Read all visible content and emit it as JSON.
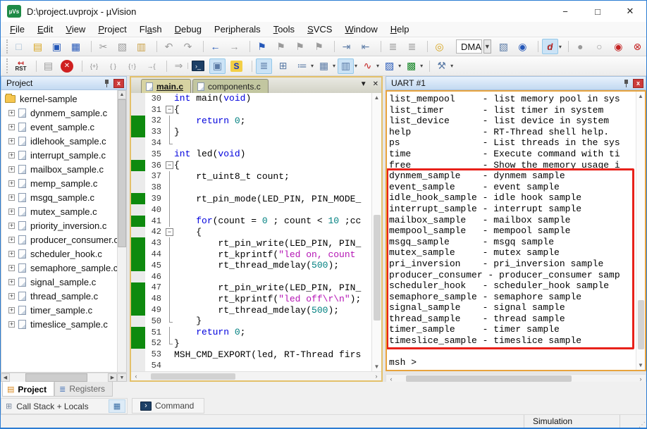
{
  "window": {
    "title": "D:\\project.uvprojx - µVision",
    "logo_text": "µVs",
    "controls": {
      "minimize": "−",
      "maximize": "□",
      "close": "✕"
    }
  },
  "menu": {
    "items": [
      {
        "pre": "",
        "key": "F",
        "post": "ile"
      },
      {
        "pre": "",
        "key": "E",
        "post": "dit"
      },
      {
        "pre": "",
        "key": "V",
        "post": "iew"
      },
      {
        "pre": "",
        "key": "P",
        "post": "roject"
      },
      {
        "pre": "Fl",
        "key": "a",
        "post": "sh"
      },
      {
        "pre": "",
        "key": "D",
        "post": "ebug"
      },
      {
        "pre": "Per",
        "key": "i",
        "post": "pherals"
      },
      {
        "pre": "",
        "key": "T",
        "post": "ools"
      },
      {
        "pre": "",
        "key": "S",
        "post": "VCS"
      },
      {
        "pre": "",
        "key": "W",
        "post": "indow"
      },
      {
        "pre": "",
        "key": "H",
        "post": "elp"
      }
    ]
  },
  "toolbar1a": [
    {
      "name": "new-file-button",
      "g": "□",
      "cls": "c-sky",
      "dd": ""
    },
    {
      "name": "open-button",
      "g": "▤",
      "cls": "c-yellow",
      "dd": ""
    },
    {
      "name": "save-button",
      "g": "▣",
      "cls": "c-blue",
      "dd": ""
    },
    {
      "name": "save-all-button",
      "g": "▦",
      "cls": "c-blue",
      "dd": ""
    },
    {
      "name": "cut-button",
      "g": "✂",
      "cls": "c-gray gs",
      "dd": ""
    },
    {
      "name": "copy-button",
      "g": "▧",
      "cls": "c-gray",
      "dd": ""
    },
    {
      "name": "paste-button",
      "g": "▥",
      "cls": "c-tan",
      "dd": ""
    },
    {
      "name": "undo-button",
      "g": "↶",
      "cls": "c-gray gs",
      "dd": ""
    },
    {
      "name": "redo-button",
      "g": "↷",
      "cls": "c-gray",
      "dd": ""
    },
    {
      "name": "nav-back-button",
      "g": "←",
      "cls": "c-blue gs",
      "dd": ""
    },
    {
      "name": "nav-forward-button",
      "g": "→",
      "cls": "c-gray",
      "dd": ""
    },
    {
      "name": "bookmark-button",
      "g": "⚑",
      "cls": "c-blue gs",
      "dd": ""
    },
    {
      "name": "next-bookmark-button",
      "g": "⚑",
      "cls": "c-gray",
      "dd": ""
    },
    {
      "name": "prev-bookmark-button",
      "g": "⚑",
      "cls": "c-gray",
      "dd": ""
    },
    {
      "name": "clear-bookmarks-button",
      "g": "⚑",
      "cls": "c-gray",
      "dd": ""
    },
    {
      "name": "indent-button",
      "g": "⇥",
      "cls": "c-slate gs",
      "dd": ""
    },
    {
      "name": "outdent-button",
      "g": "⇤",
      "cls": "c-slate",
      "dd": ""
    },
    {
      "name": "comment-button",
      "g": "≣",
      "cls": "c-gray gs",
      "dd": ""
    },
    {
      "name": "uncomment-button",
      "g": "≣",
      "cls": "c-gray",
      "dd": ""
    },
    {
      "name": "find-in-files-button",
      "g": "◎",
      "cls": "c-yellow gs",
      "dd": ""
    }
  ],
  "find_combo": {
    "value": "DMA",
    "arrow": "▼"
  },
  "toolbar1b": [
    {
      "name": "find-next-button",
      "g": "▧",
      "cls": "c-slate",
      "dd": ""
    },
    {
      "name": "incremental-find-button",
      "g": "◉",
      "cls": "c-blue",
      "dd": ""
    },
    {
      "name": "debug-session-button",
      "g": "d",
      "cls": "c-red pressed circ gs",
      "dd": "▾"
    },
    {
      "name": "insert-breakpoint-button",
      "g": "●",
      "cls": "c-gray gs",
      "dd": ""
    },
    {
      "name": "enable-breakpoint-button",
      "g": "○",
      "cls": "c-gray",
      "dd": ""
    },
    {
      "name": "disable-all-breakpoints-button",
      "g": "◉",
      "cls": "c-red",
      "dd": ""
    },
    {
      "name": "kill-all-breakpoints-button",
      "g": "⊗",
      "cls": "c-red",
      "dd": ""
    },
    {
      "name": "window-layout-button",
      "g": "▦",
      "cls": "c-blue pressed gs",
      "dd": ""
    }
  ],
  "toolbar2": [
    {
      "name": "reset-button",
      "g": "RST",
      "cls": "rst",
      "dd": ""
    },
    {
      "name": "run-button",
      "g": "▤",
      "cls": "c-gray gs",
      "dd": ""
    },
    {
      "name": "stop-button",
      "g": "✕",
      "cls": "stop",
      "dd": ""
    },
    {
      "name": "step-button",
      "g": "{+}",
      "cls": "txt gs",
      "dd": ""
    },
    {
      "name": "step-over-button",
      "g": "{ }",
      "cls": "txt",
      "dd": ""
    },
    {
      "name": "step-out-button",
      "g": "{↑}",
      "cls": "txt",
      "dd": ""
    },
    {
      "name": "run-to-line-button",
      "g": "→{",
      "cls": "txt",
      "dd": ""
    },
    {
      "name": "show-next-statement-button",
      "g": "⇒",
      "cls": "c-gray gs",
      "dd": ""
    },
    {
      "name": "command-window-button",
      "g": "›_",
      "cls": "cmdw gs",
      "dd": ""
    },
    {
      "name": "disassembly-window-button",
      "g": "▣",
      "cls": "c-slate pressed",
      "dd": ""
    },
    {
      "name": "symbol-window-button",
      "g": "S",
      "cls": "sym",
      "dd": ""
    },
    {
      "name": "registers-window-button",
      "g": "≣",
      "cls": "c-slate pressed gs",
      "dd": ""
    },
    {
      "name": "call-stack-window-button",
      "g": "⊞",
      "cls": "c-slate",
      "dd": ""
    },
    {
      "name": "watch-window-button",
      "g": "≔",
      "cls": "c-slate",
      "dd": "▾"
    },
    {
      "name": "memory-window-button",
      "g": "▦",
      "cls": "c-slate",
      "dd": "▾"
    },
    {
      "name": "serial-window-button",
      "g": "▥",
      "cls": "c-slate pressed",
      "dd": "▾"
    },
    {
      "name": "analysis-window-button",
      "g": "∿",
      "cls": "c-red",
      "dd": "▾"
    },
    {
      "name": "trace-window-button",
      "g": "▨",
      "cls": "c-blue",
      "dd": "▾"
    },
    {
      "name": "system-viewer-button",
      "g": "▩",
      "cls": "c-green",
      "dd": "▾"
    },
    {
      "name": "toolbox-button",
      "g": "⚒",
      "cls": "c-slate gs",
      "dd": "▾"
    }
  ],
  "project_panel": {
    "title": "Project",
    "root": "kernel-sample",
    "files": [
      "dynmem_sample.c",
      "event_sample.c",
      "idlehook_sample.c",
      "interrupt_sample.c",
      "mailbox_sample.c",
      "memp_sample.c",
      "msgq_sample.c",
      "mutex_sample.c",
      "priority_inversion.c",
      "producer_consumer.c",
      "scheduler_hook.c",
      "semaphore_sample.c",
      "signal_sample.c",
      "thread_sample.c",
      "timer_sample.c",
      "timeslice_sample.c"
    ]
  },
  "editor": {
    "tabs": [
      {
        "label": "main.c"
      },
      {
        "label": "components.c"
      }
    ],
    "tab_overflow": "▼",
    "tab_close": "✕",
    "lines": [
      {
        "n": "30",
        "t": "int main(void)",
        "f": "",
        "cc": ""
      },
      {
        "n": "31",
        "t": "{",
        "f": "box",
        "cc": ""
      },
      {
        "n": "32",
        "t": "    return 0;",
        "f": "v",
        "cc": "on"
      },
      {
        "n": "33",
        "t": "}",
        "f": "v",
        "cc": "on"
      },
      {
        "n": "34",
        "t": "",
        "f": "end",
        "cc": ""
      },
      {
        "n": "35",
        "t": "int led(void)",
        "f": "",
        "cc": ""
      },
      {
        "n": "36",
        "t": "{",
        "f": "box",
        "cc": "on"
      },
      {
        "n": "37",
        "t": "    rt_uint8_t count;",
        "f": "v",
        "cc": ""
      },
      {
        "n": "38",
        "t": "",
        "f": "v",
        "cc": ""
      },
      {
        "n": "39",
        "t": "    rt_pin_mode(LED_PIN, PIN_MODE_",
        "f": "v",
        "cc": "on"
      },
      {
        "n": "40",
        "t": "",
        "f": "v",
        "cc": ""
      },
      {
        "n": "41",
        "t": "    for(count = 0 ; count < 10 ;cc",
        "f": "v",
        "cc": "on"
      },
      {
        "n": "42",
        "t": "    {",
        "f": "box",
        "cc": ""
      },
      {
        "n": "43",
        "t": "        rt_pin_write(LED_PIN, PIN_",
        "f": "v",
        "cc": "on"
      },
      {
        "n": "44",
        "t": "        rt_kprintf(\"led on, count",
        "f": "v",
        "cc": "on"
      },
      {
        "n": "45",
        "t": "        rt_thread_mdelay(500);",
        "f": "v",
        "cc": "on"
      },
      {
        "n": "46",
        "t": "",
        "f": "v",
        "cc": ""
      },
      {
        "n": "47",
        "t": "        rt_pin_write(LED_PIN, PIN_",
        "f": "v",
        "cc": "on"
      },
      {
        "n": "48",
        "t": "        rt_kprintf(\"led off\\r\\n\");",
        "f": "v",
        "cc": "on"
      },
      {
        "n": "49",
        "t": "        rt_thread_mdelay(500);",
        "f": "v",
        "cc": "on"
      },
      {
        "n": "50",
        "t": "    }",
        "f": "end",
        "cc": ""
      },
      {
        "n": "51",
        "t": "    return 0;",
        "f": "v",
        "cc": "on"
      },
      {
        "n": "52",
        "t": "}",
        "f": "end",
        "cc": "on"
      },
      {
        "n": "53",
        "t": "MSH_CMD_EXPORT(led, RT-Thread firs",
        "f": "",
        "cc": ""
      },
      {
        "n": "54",
        "t": "",
        "f": "",
        "cc": ""
      }
    ]
  },
  "uart": {
    "title": "UART #1",
    "lines": [
      "list_mempool     - list memory pool in sys",
      "list_timer       - list timer in system",
      "list_device      - list device in system",
      "help             - RT-Thread shell help.",
      "ps               - List threads in the sys",
      "time             - Execute command with ti",
      "free             - Show the memory usage i",
      "dynmem_sample    - dynmem sample",
      "event_sample     - event sample",
      "idle_hook_sample - idle hook sample",
      "interrupt_sample - interrupt sample",
      "mailbox_sample   - mailbox sample",
      "mempool_sample   - mempool sample",
      "msgq_sample      - msgq sample",
      "mutex_sample     - mutex sample",
      "pri_inversion    - pri_inversion sample",
      "producer_consumer - producer_consumer samp",
      "scheduler_hook   - scheduler_hook sample",
      "semaphore_sample - semaphore sample",
      "signal_sample    - signal sample",
      "thread_sample    - thread sample",
      "timer_sample     - timer sample",
      "timeslice_sample - timeslice sample",
      "",
      "msh >"
    ]
  },
  "bottom": {
    "tabs": [
      {
        "label": "Project"
      },
      {
        "label": "Registers"
      }
    ],
    "call_stack_label": "Call Stack + Locals",
    "command_label": "Command"
  },
  "status_bar": {
    "mode": "Simulation"
  }
}
